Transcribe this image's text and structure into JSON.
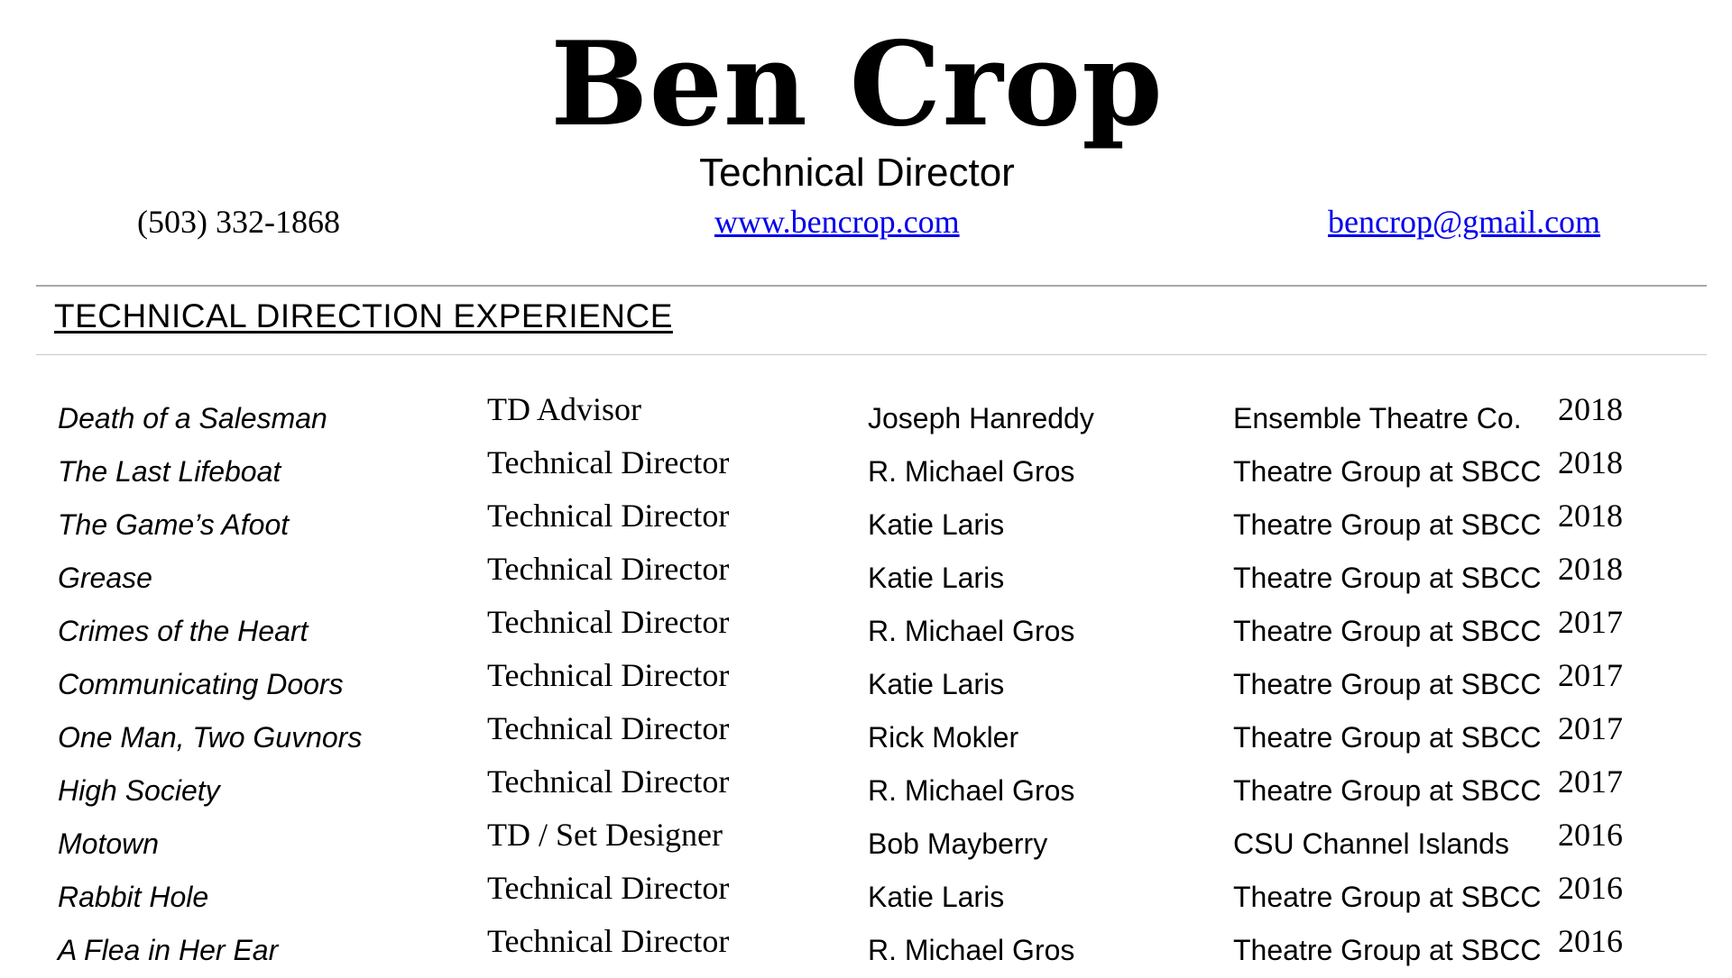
{
  "header": {
    "name": "Ben Crop",
    "subtitle": "Technical Director",
    "phone": "(503)  332-1868",
    "website": "www.bencrop.com",
    "email": "bencrop@gmail.com",
    "link_color": "#0000ee"
  },
  "section": {
    "title": "TECHNICAL DIRECTION EXPERIENCE"
  },
  "experience": [
    {
      "show": "Death of a Salesman",
      "role": "TD Advisor",
      "director": "Joseph Hanreddy",
      "company": "Ensemble Theatre Co.",
      "year": "2018"
    },
    {
      "show": "The Last Lifeboat",
      "role": "Technical Director",
      "director": "R. Michael Gros",
      "company": "Theatre Group at SBCC",
      "year": "2018"
    },
    {
      "show": "The Game’s Afoot",
      "role": "Technical Director",
      "director": "Katie Laris",
      "company": "Theatre Group at SBCC",
      "year": "2018"
    },
    {
      "show": "Grease",
      "role": "Technical Director",
      "director": "Katie Laris",
      "company": "Theatre Group at SBCC",
      "year": "2018"
    },
    {
      "show": "Crimes of the Heart",
      "role": "Technical Director",
      "director": "R. Michael Gros",
      "company": "Theatre Group at SBCC",
      "year": "2017"
    },
    {
      "show": "Communicating Doors",
      "role": "Technical Director",
      "director": "Katie Laris",
      "company": "Theatre Group at SBCC",
      "year": "2017"
    },
    {
      "show": "One Man, Two Guvnors",
      "role": "Technical Director",
      "director": "Rick Mokler",
      "company": "Theatre Group at SBCC",
      "year": "2017"
    },
    {
      "show": "High Society",
      "role": "Technical Director",
      "director": "R. Michael Gros",
      "company": "Theatre Group at SBCC",
      "year": "2017"
    },
    {
      "show": "Motown",
      "role": "TD / Set Designer",
      "director": "Bob Mayberry",
      "company": "CSU Channel Islands",
      "year": "2016"
    },
    {
      "show": "Rabbit Hole",
      "role": "Technical Director",
      "director": "Katie Laris",
      "company": "Theatre Group at SBCC",
      "year": "2016"
    },
    {
      "show": "A Flea in Her Ear",
      "role": "Technical Director",
      "director": "R. Michael Gros",
      "company": "Theatre Group at SBCC",
      "year": "2016"
    }
  ]
}
